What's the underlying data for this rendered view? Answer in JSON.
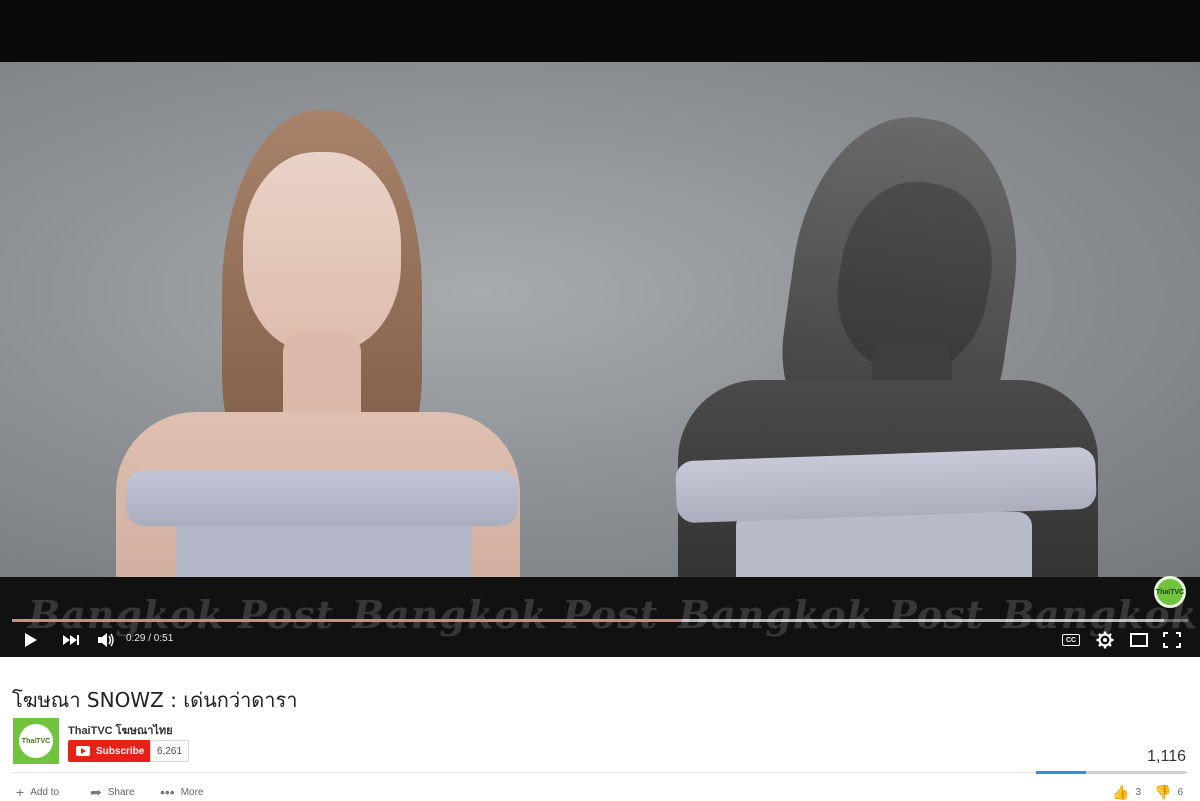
{
  "player": {
    "current_time": "0:29",
    "duration": "0:51",
    "time_display": "0:29 / 0:51",
    "progress_fraction": 0.569,
    "buffer_fraction": 0.98,
    "watermark_text": "Bangkok Post",
    "channel_bug_text": "ThaiTVC",
    "cc_label": "CC",
    "colors": {
      "progress": "#d08a82",
      "background": "#0c0c0c"
    }
  },
  "video": {
    "title": "โฆษณา SNOWZ : เด่นกว่าดารา",
    "channel_name": "ThaiTVC โฆษณาไทย",
    "avatar_text": "ThaiTVC",
    "subscribe_label": "Subscribe",
    "subscriber_count": "6,261",
    "view_count": "1,116",
    "likes": "3",
    "dislikes": "6",
    "like_fraction": 0.33,
    "actions": {
      "add_to": "Add to",
      "share": "Share",
      "more": "More"
    },
    "colors": {
      "subscribe": "#e62117",
      "sentiment": "#2793e6",
      "channel": "#6fc33d"
    }
  }
}
